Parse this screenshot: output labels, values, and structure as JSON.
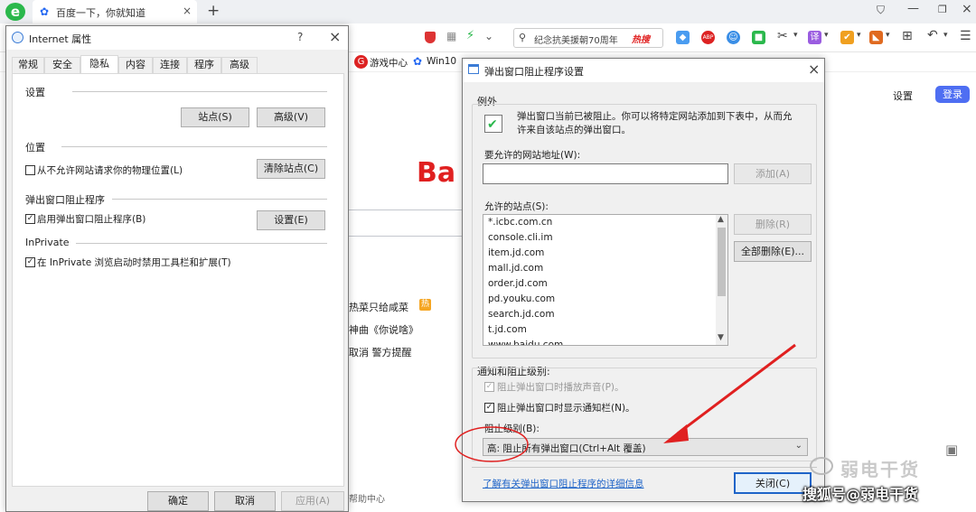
{
  "browser": {
    "tab_title": "百度一下，你就知道",
    "search_text": "纪念抗美援朝70周年",
    "hot_badge": "热搜",
    "bookmarks": [
      "游戏中心",
      "Win10"
    ],
    "page": {
      "settings": "设置",
      "login": "登录",
      "baidu_logo": "Ba",
      "news": [
        "热菜只给咸菜",
        "神曲《你说啥》",
        "取消 警方提醒"
      ],
      "hot_tag": "热",
      "help": "帮助中心"
    }
  },
  "internet_options": {
    "title": "Internet 属性",
    "help_btn": "?",
    "close_btn": "×",
    "tabs": [
      "常规",
      "安全",
      "隐私",
      "内容",
      "连接",
      "程序",
      "高级"
    ],
    "settings_header": "设置",
    "sites_btn": "站点(S)",
    "advanced_btn": "高级(V)",
    "location_header": "位置",
    "location_cb": "从不允许网站请求你的物理位置(L)",
    "clear_sites_btn": "清除站点(C)",
    "popup_header": "弹出窗口阻止程序",
    "popup_cb": "启用弹出窗口阻止程序(B)",
    "popup_settings_btn": "设置(E)",
    "inprivate_header": "InPrivate",
    "inprivate_cb": "在 InPrivate 浏览启动时禁用工具栏和扩展(T)",
    "ok_btn": "确定",
    "cancel_btn": "取消",
    "apply_btn": "应用(A)"
  },
  "popup_blocker": {
    "title": "弹出窗口阻止程序设置",
    "close_btn": "×",
    "exceptions_header": "例外",
    "info_text": "弹出窗口当前已被阻止。你可以将特定网站添加到下表中，从而允许来自该站点的弹出窗口。",
    "address_label": "要允许的网站地址(W):",
    "add_btn": "添加(A)",
    "allowed_label": "允许的站点(S):",
    "allowed_sites": [
      "*.icbc.com.cn",
      "console.cli.im",
      "item.jd.com",
      "mall.jd.com",
      "order.jd.com",
      "pd.youku.com",
      "search.jd.com",
      "t.jd.com",
      "www.baidu.com"
    ],
    "remove_btn": "删除(R)",
    "remove_all_btn": "全部删除(E)...",
    "notify_header": "通知和阻止级别:",
    "sound_cb": "阻止弹出窗口时播放声音(P)。",
    "notifybar_cb": "阻止弹出窗口时显示通知栏(N)。",
    "level_label": "阻止级别(B):",
    "level_value": "高: 阻止所有弹出窗口(Ctrl+Alt 覆盖)",
    "learn_more_link": "了解有关弹出窗口阻止程序的详细信息",
    "close_dialog_btn": "关闭(C)"
  },
  "watermark": {
    "top": "弱电干货",
    "bottom": "搜狐号@弱电干货"
  },
  "colors": {
    "accent": "#1e64c8",
    "annotation_red": "#e02020",
    "baidu_red": "#e02020",
    "login_blue": "#4e6ef2"
  }
}
